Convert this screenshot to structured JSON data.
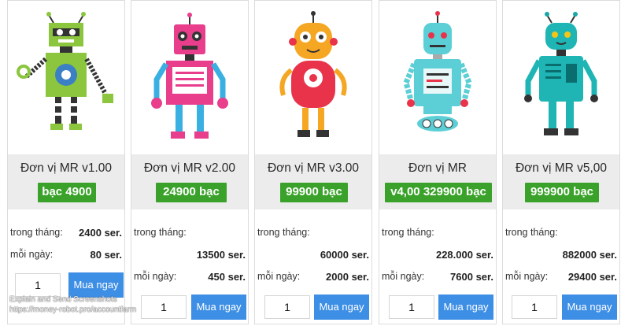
{
  "products": [
    {
      "name": "Đơn vị MR v1.00",
      "price": "bạc 4900",
      "monthly_label": "trong tháng:",
      "monthly_value": "2400 ser.",
      "daily_label": "mỗi ngày:",
      "daily_value": "80 ser.",
      "quantity": "1",
      "buy_label": "Mua ngay",
      "robot_icon": "green-robot-icon"
    },
    {
      "name": "Đơn vị MR v2.00",
      "price": "24900 bạc",
      "monthly_label": "trong tháng:",
      "monthly_value": "13500 ser.",
      "daily_label": "mỗi ngày:",
      "daily_value": "450 ser.",
      "quantity": "1",
      "buy_label": "Mua ngay",
      "robot_icon": "pink-robot-icon"
    },
    {
      "name": "Đơn vị MR v3.00",
      "price": "99900 bạc",
      "monthly_label": "trong tháng:",
      "monthly_value": "60000 ser.",
      "daily_label": "mỗi ngày:",
      "daily_value": "2000 ser.",
      "quantity": "1",
      "buy_label": "Mua ngay",
      "robot_icon": "red-robot-icon"
    },
    {
      "name": "Đơn vị MR",
      "price": "v4,00 329900 bạc",
      "monthly_label": "trong tháng:",
      "monthly_value": "228.000 ser.",
      "daily_label": "mỗi ngày:",
      "daily_value": "7600 ser.",
      "quantity": "1",
      "buy_label": "Mua ngay",
      "robot_icon": "cyan-robot-icon"
    },
    {
      "name": "Đơn vị MR v5,00",
      "price": "999900 bạc",
      "monthly_label": "trong tháng:",
      "monthly_value": "882000 ser.",
      "daily_label": "mỗi ngày:",
      "daily_value": "29400 ser.",
      "quantity": "1",
      "buy_label": "Mua ngay",
      "robot_icon": "teal-robot-icon"
    }
  ],
  "watermark": {
    "line1": "Explain and Send Screenshots",
    "line2": "https://money-robot.pro/accountfarm"
  },
  "colors": {
    "price_badge": "#3aa22a",
    "buy_button": "#3d8ee5",
    "title_band": "#ececec"
  }
}
